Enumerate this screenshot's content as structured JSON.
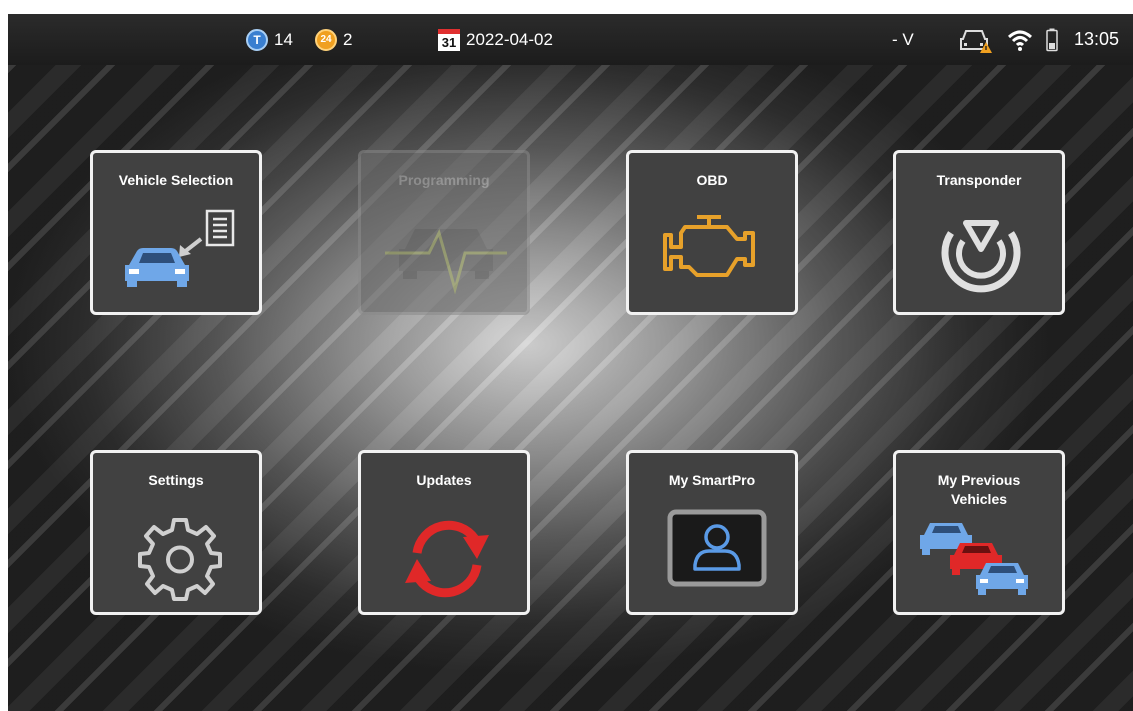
{
  "status_bar": {
    "t_count": "14",
    "t_badge": "T",
    "token24_count": "2",
    "token24_badge": "24",
    "calendar_day": "31",
    "date": "2022-04-02",
    "voltage": "- V",
    "time": "13:05",
    "icons": [
      "t-token-icon",
      "24-token-icon",
      "calendar-icon",
      "vehicle-warning-icon",
      "wifi-icon",
      "battery-icon"
    ]
  },
  "tiles": {
    "vehicle_selection": "Vehicle Selection",
    "programming": "Programming",
    "obd": "OBD",
    "transponder": "Transponder",
    "settings": "Settings",
    "updates": "Updates",
    "my_smartpro": "My SmartPro",
    "my_previous_vehicles": "My Previous Vehicles"
  },
  "colors": {
    "blue_car": "#6fa7e8",
    "engine": "#e7a12a",
    "update_red": "#e02828",
    "tile_bg": "#414141"
  }
}
